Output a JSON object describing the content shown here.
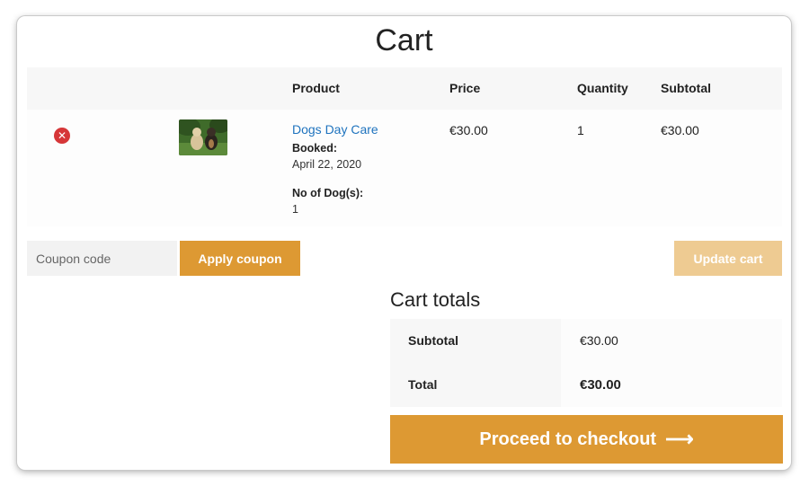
{
  "page": {
    "title": "Cart"
  },
  "table": {
    "headers": {
      "product": "Product",
      "price": "Price",
      "quantity": "Quantity",
      "subtotal": "Subtotal"
    },
    "items": [
      {
        "remove_icon": "close-circle-icon",
        "product_name": "Dogs Day Care",
        "meta": [
          {
            "label": "Booked:",
            "value": "April 22, 2020"
          },
          {
            "label": "No of Dog(s):",
            "value": "1"
          }
        ],
        "price": "€30.00",
        "quantity": "1",
        "subtotal": "€30.00"
      }
    ]
  },
  "coupon": {
    "placeholder": "Coupon code",
    "apply_label": "Apply coupon"
  },
  "update_label": "Update cart",
  "totals": {
    "title": "Cart totals",
    "rows": [
      {
        "label": "Subtotal",
        "value": "€30.00"
      },
      {
        "label": "Total",
        "value": "€30.00"
      }
    ]
  },
  "checkout": {
    "label": "Proceed to checkout",
    "icon": "arrow-right-icon"
  },
  "colors": {
    "accent": "#dd9933",
    "accent_disabled": "#eecb92",
    "link": "#1e73be",
    "remove": "#d63638"
  }
}
